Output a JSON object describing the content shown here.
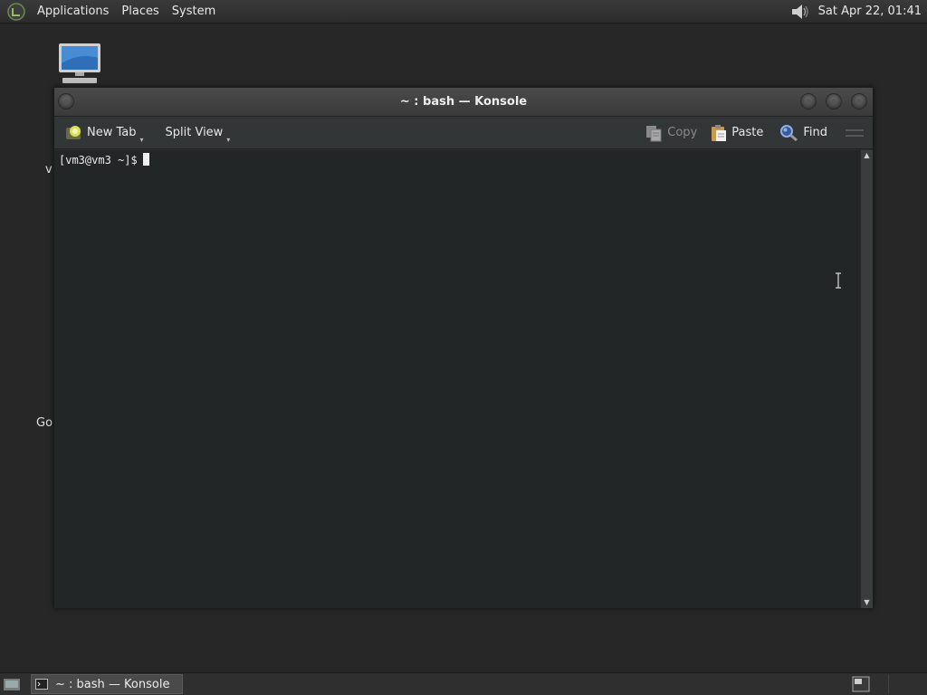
{
  "top_panel": {
    "menus": [
      "Applications",
      "Places",
      "System"
    ],
    "clock": "Sat Apr 22, 01:41"
  },
  "desktop": {
    "icon_labels": [
      "vi",
      "Go"
    ]
  },
  "window": {
    "title": "~ : bash — Konsole",
    "toolbar": {
      "new_tab": "New Tab",
      "split_view": "Split View",
      "copy": "Copy",
      "paste": "Paste",
      "find": "Find"
    },
    "terminal": {
      "prompt": "[vm3@vm3 ~]$"
    }
  },
  "taskbar": {
    "konsole_task": "~ : bash — Konsole"
  },
  "colors": {
    "terminal_bg": "#232627",
    "desktop_bg": "#272727"
  }
}
